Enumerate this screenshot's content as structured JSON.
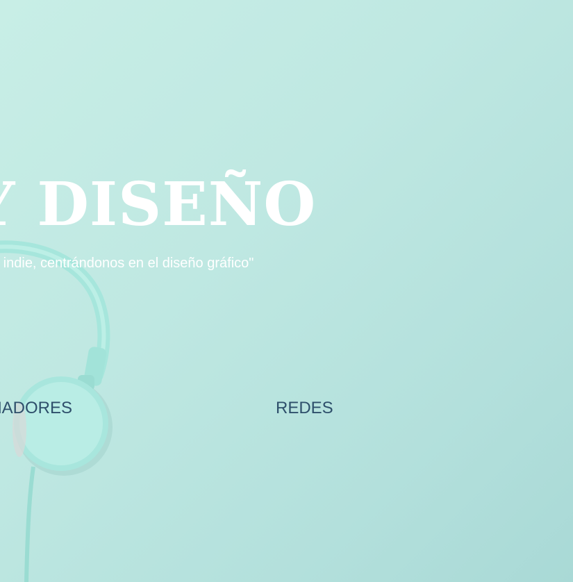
{
  "hero": {
    "title": "Y DISEÑO",
    "subtitle": "a indie, centrándonos en el diseño gráfico\""
  },
  "nav": {
    "items": [
      {
        "label": "ÑADORES"
      },
      {
        "label": "REDES"
      }
    ]
  },
  "colors": {
    "background": "#bfe8e2",
    "title": "#ffffff",
    "nav_text": "#2e4f6b",
    "headphones": "#9fe3d9"
  },
  "image": {
    "subject": "headphones-image"
  }
}
